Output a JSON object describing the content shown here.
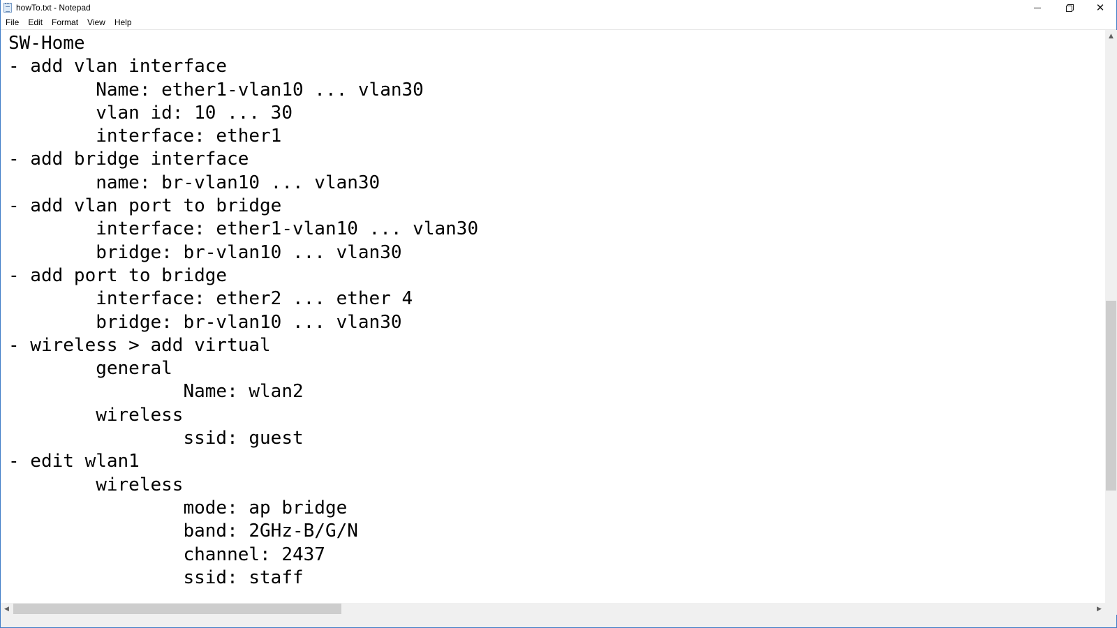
{
  "window": {
    "title": "howTo.txt - Notepad",
    "app_icon": "notepad-icon",
    "controls": {
      "minimize_icon": "minimize-icon",
      "maximize_icon": "restore-icon",
      "close_icon": "close-icon"
    }
  },
  "menu": {
    "file": "File",
    "edit": "Edit",
    "format": "Format",
    "view": "View",
    "help": "Help"
  },
  "editor": {
    "content": "SW-Home\n- add vlan interface\n        Name: ether1-vlan10 ... vlan30\n        vlan id: 10 ... 30\n        interface: ether1\n- add bridge interface\n        name: br-vlan10 ... vlan30\n- add vlan port to bridge\n        interface: ether1-vlan10 ... vlan30\n        bridge: br-vlan10 ... vlan30\n- add port to bridge\n        interface: ether2 ... ether 4\n        bridge: br-vlan10 ... vlan30\n- wireless > add virtual\n        general\n                Name: wlan2\n        wireless\n                ssid: guest\n- edit wlan1\n        wireless\n                mode: ap bridge\n                band: 2GHz-B/G/N\n                channel: 2437\n                ssid: staff"
  },
  "scrollbars": {
    "vertical_up_icon": "arrow-up-icon",
    "vertical_down_icon": "arrow-down-icon",
    "horizontal_left_icon": "arrow-left-icon",
    "horizontal_right_icon": "arrow-right-icon"
  },
  "colors": {
    "window_border": "#3f7cc7",
    "scrollbar_track": "#f0f0f0",
    "scrollbar_thumb": "#cdcdcd"
  }
}
